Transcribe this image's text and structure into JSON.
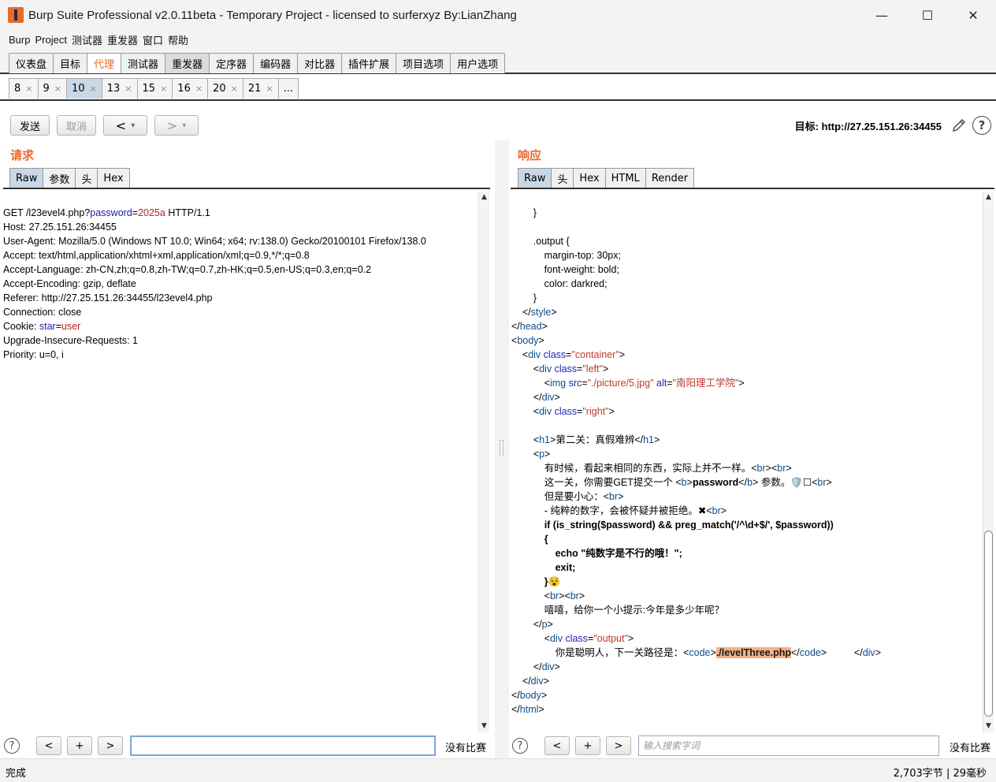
{
  "window": {
    "title": "Burp Suite Professional v2.0.11beta - Temporary Project - licensed to surferxyz By:LianZhang",
    "minimize": "—",
    "maximize": "☐",
    "close": "✕"
  },
  "menu": [
    "Burp",
    "Project",
    "测试器",
    "重发器",
    "窗口",
    "帮助"
  ],
  "main_tabs": [
    "仪表盘",
    "目标",
    "代理",
    "测试器",
    "重发器",
    "定序器",
    "编码器",
    "对比器",
    "插件扩展",
    "项目选项",
    "用户选项"
  ],
  "repeater_tabs": [
    "8",
    "9",
    "10",
    "13",
    "15",
    "16",
    "20",
    "21",
    "..."
  ],
  "tab_close": "×",
  "toolbar": {
    "send": "发送",
    "cancel": "取消",
    "back": "<",
    "forward": ">",
    "dropdown": "▾",
    "target": "目标: http://27.25.151.26:34455",
    "edit_icon": "pencil-icon",
    "help": "?"
  },
  "request": {
    "title": "请求",
    "tabs": [
      "Raw",
      "参数",
      "头",
      "Hex"
    ],
    "line1": {
      "a": "GET /l23evel4.php?",
      "b": "password",
      "c": "=",
      "d": "2025a",
      "e": " HTTP/1.1"
    },
    "lines": [
      "Host: 27.25.151.26:34455",
      "User-Agent: Mozilla/5.0 (Windows NT 10.0; Win64; x64; rv:138.0) Gecko/20100101 Firefox/138.0",
      "Accept: text/html,application/xhtml+xml,application/xml;q=0.9,*/*;q=0.8",
      "Accept-Language: zh-CN,zh;q=0.8,zh-TW;q=0.7,zh-HK;q=0.5,en-US;q=0.3,en;q=0.2",
      "Accept-Encoding: gzip, deflate",
      "Referer: http://27.25.151.26:34455/l23evel4.php",
      "Connection: close"
    ],
    "cookie": {
      "a": "Cookie: ",
      "b": "star",
      "c": "=",
      "d": "user"
    },
    "lines2": [
      "Upgrade-Insecure-Requests: 1",
      "Priority: u=0, i"
    ],
    "search_prev": "<",
    "search_add": "+",
    "search_next": ">",
    "search_help": "?",
    "search_value": "",
    "no_match": "没有比赛"
  },
  "response": {
    "title": "响应",
    "tabs": [
      "Raw",
      "头",
      "Hex",
      "HTML",
      "Render"
    ],
    "search_placeholder": "输入搜索字词",
    "search_prev": "<",
    "search_add": "+",
    "search_next": ">",
    "search_help": "?",
    "no_match": "没有比赛",
    "code": {
      "l01": "        }",
      "l02": "",
      "l03": "        .output {",
      "l04": "            margin-top: 30px;",
      "l05": "            font-weight: bold;",
      "l06": "            color: darkred;",
      "l07": "        }",
      "l08_t": "style",
      "l09_t": "head",
      "l10_t": "body",
      "div": "div",
      "class": "class",
      "container": "\"container\"",
      "left": "\"left\"",
      "img": "img",
      "src": "src",
      "src_v": "\"./picture/5.jpg\"",
      "alt": "alt",
      "alt_v": "\"南阳理工学院\"",
      "right": "\"right\"",
      "h1": "h1",
      "h1_text": "第二关：真假难辨",
      "p": "p",
      "br": "br",
      "b": "b",
      "p_l1": "有时候，看起来相同的东西，实际上并不一样。",
      "p_l2a": "这一关，你需要GET提交一个 ",
      "p_l2b": "password",
      "p_l2c": " 参数。",
      "p_l2_emoji": "🛡️☐",
      "p_l3": "但是要小心：",
      "p_l4": "- 纯粹的数字，会被怀疑并被拒绝。",
      "p_l4_emoji": "✖",
      "p_l5": "if (is_string($password) && preg_match('/^\\d+$/', $password))",
      "p_l6": "{",
      "p_l7": "echo \"纯数字是不行的哦！\";",
      "p_l8": "exit;",
      "p_l9": "}",
      "p_l9_emoji": "😵",
      "p_l11": "嘻嘻，给你一个小提示:今年是多少年呢？",
      "output": "\"output\"",
      "out_text": "你是聪明人，下一关路径是：",
      "code_tag": "code",
      "path": "./levelThree.php",
      "html": "html"
    }
  },
  "status": {
    "left": "完成",
    "right": "2,703字节 | 29毫秒"
  }
}
